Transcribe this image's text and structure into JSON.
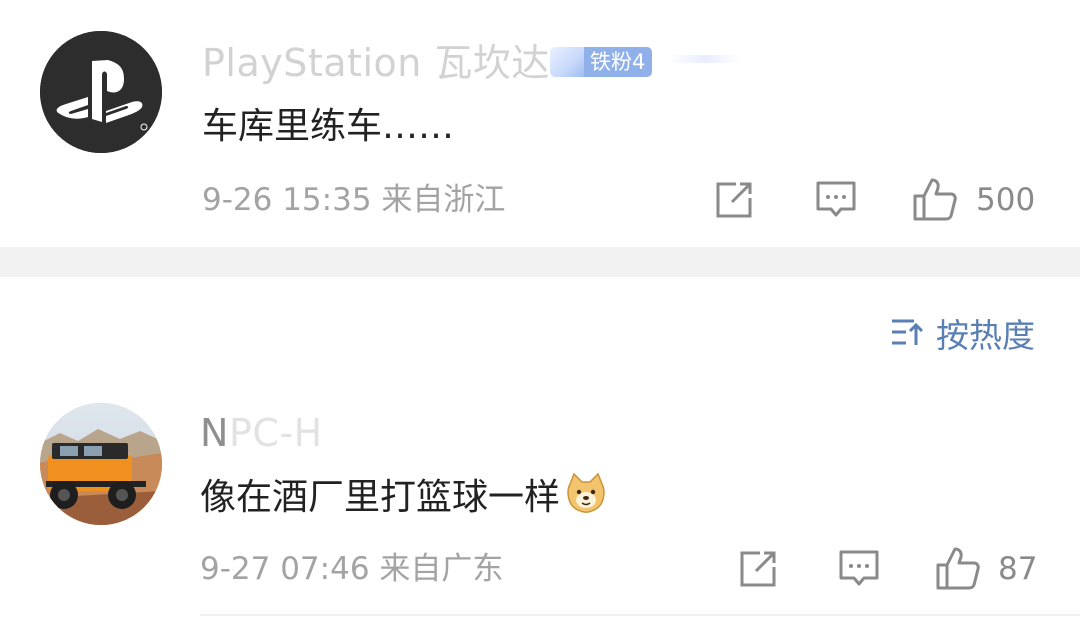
{
  "comments": [
    {
      "username": "PlayStation 瓦坎达",
      "badge": "铁粉4",
      "text": "车库里练车……",
      "meta": "9-26 15:35 来自浙江",
      "likes": "500"
    },
    {
      "username_first": "N",
      "username_rest": "PC-H",
      "text": "像在酒厂里打篮球一样",
      "meta": "9-27 07:46 来自广东",
      "likes": "87"
    }
  ],
  "sort": {
    "label": "按热度"
  },
  "icons": {
    "share": "share-icon",
    "comment": "comment-icon",
    "like": "thumbs-up-icon",
    "sort": "sort-icon",
    "emoji": "doge-emoji-icon"
  },
  "colors": {
    "badge": "#8fb0e9",
    "sort": "#5a7fb4",
    "separator": "#f2f2f2"
  }
}
